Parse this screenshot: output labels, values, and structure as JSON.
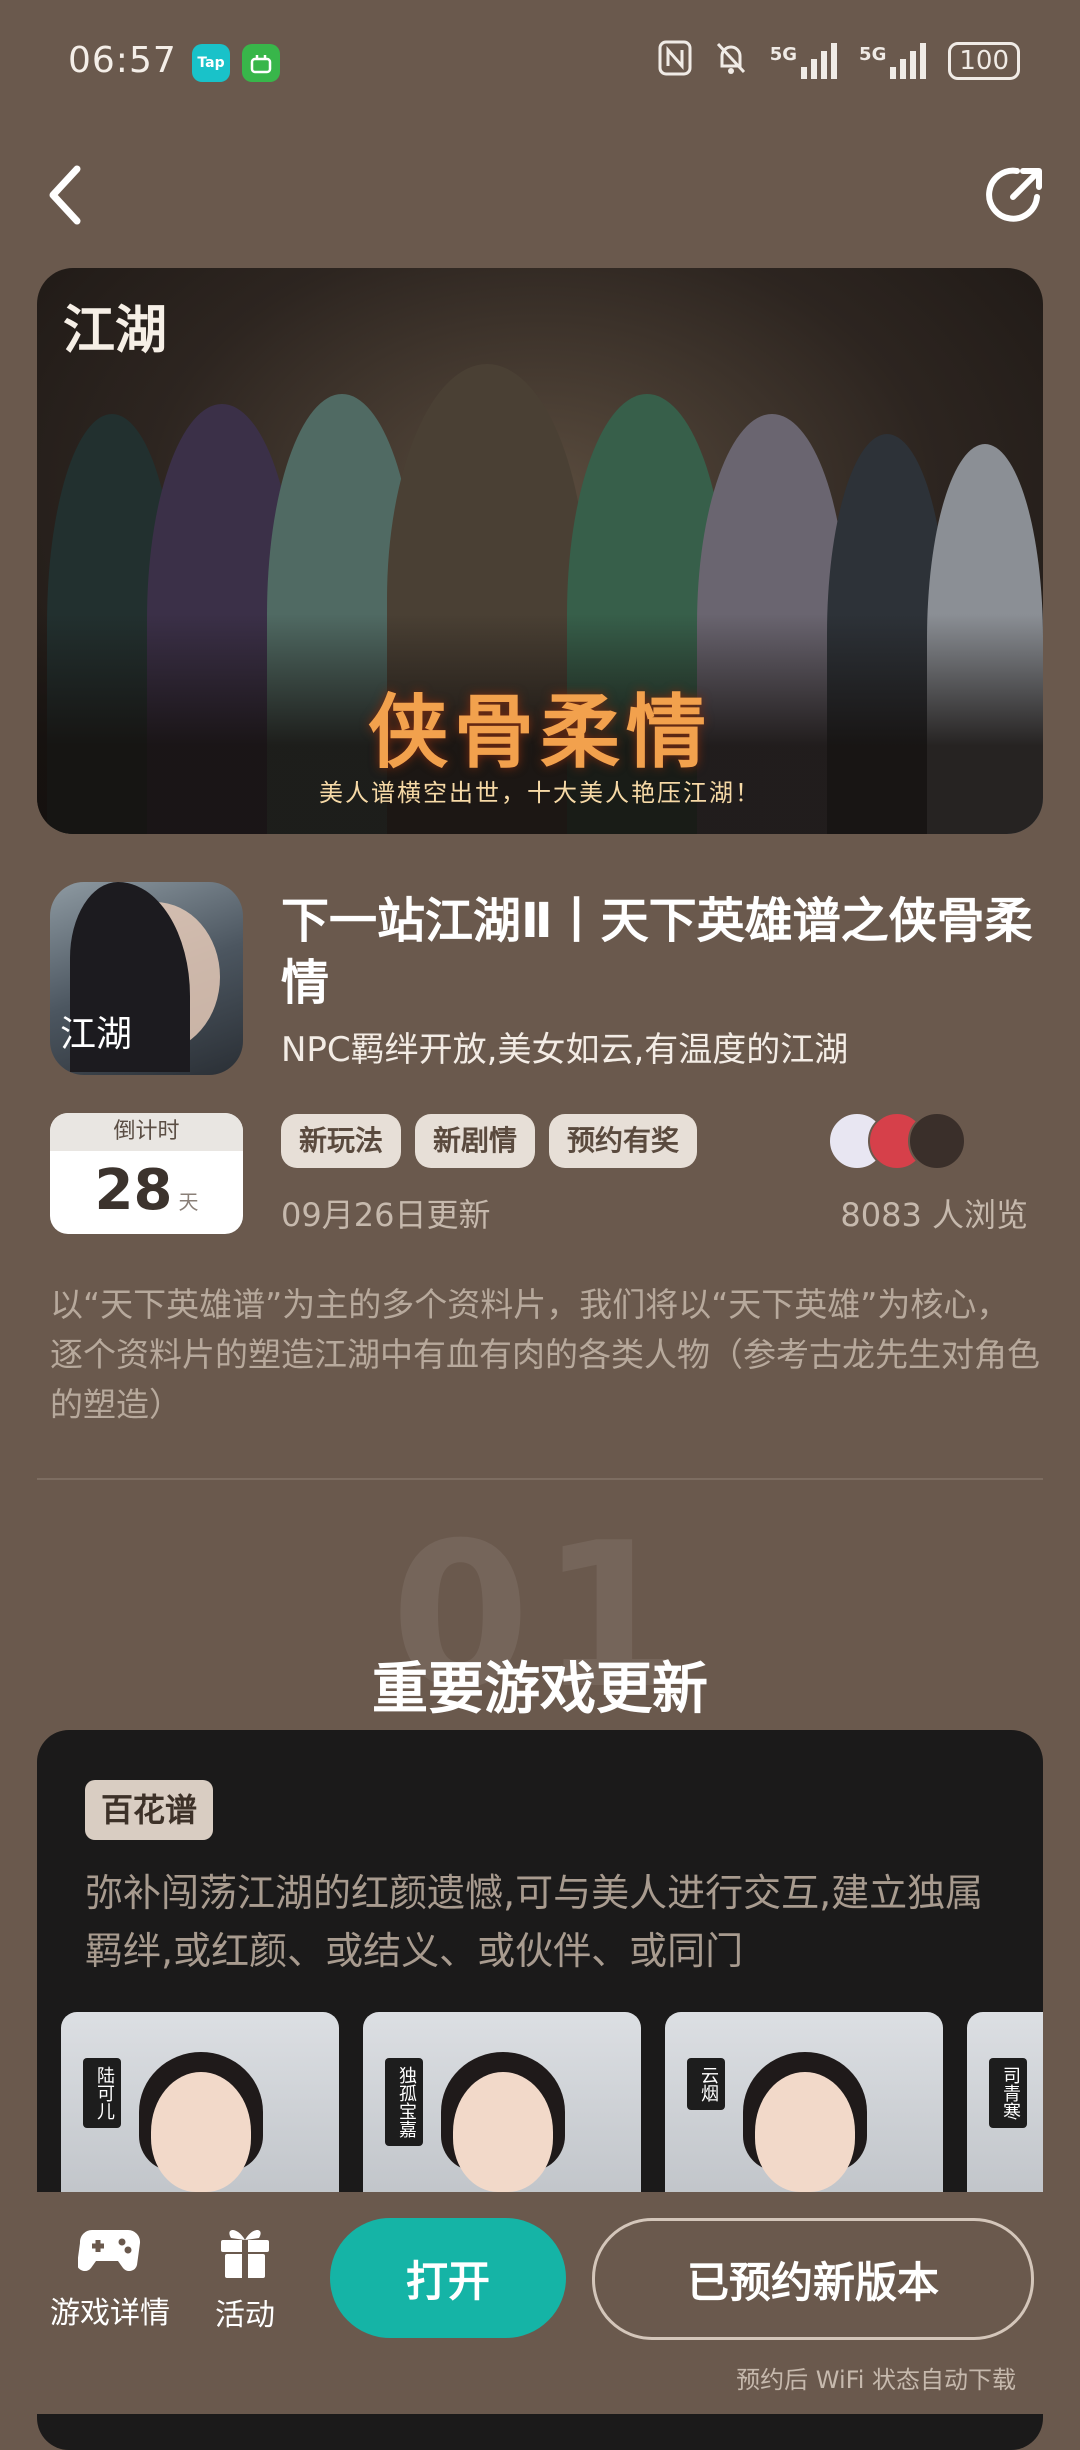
{
  "status_bar": {
    "time": "06:57",
    "app_badges": [
      "Tap",
      "应用"
    ],
    "network1": "5G",
    "network2": "5G",
    "battery": "100"
  },
  "nav": {
    "back_icon": "chevron-left-icon",
    "share_icon": "share-icon"
  },
  "banner": {
    "logo_text": "江湖",
    "title": "侠骨柔情",
    "subtitle": "美人谱横空出世，十大美人艳压江湖！"
  },
  "game": {
    "icon_text": "江湖",
    "title": "下一站江湖Ⅱ丨天下英雄谱之侠骨柔情",
    "slogan": "NPC羁绊开放,美女如云,有温度的江湖"
  },
  "countdown": {
    "label": "倒计时",
    "value": "28",
    "unit": "天"
  },
  "tags": [
    "新玩法",
    "新剧情",
    "预约有奖"
  ],
  "update_date": "09月26日更新",
  "views": "8083 人浏览",
  "description": "以“天下英雄谱”为主的多个资料片，我们将以“天下英雄”为核心，逐个资料片的塑造江湖中有血有肉的各类人物（参考古龙先生对角色的塑造）",
  "section": {
    "number": "01",
    "title": "重要游戏更新"
  },
  "feature_card": {
    "badge": "百花谱",
    "description": "弥补闯荡江湖的红颜遗憾,可与美人进行交互,建立独属羁绊,或红颜、或结义、或伙伴、或同门",
    "characters": [
      "陆可儿",
      "独孤宝嘉",
      "云烟",
      "司青寒"
    ]
  },
  "bottom_bar": {
    "tab_details": "游戏详情",
    "tab_activity": "活动",
    "open_button": "打开",
    "reserved_button": "已预约新版本",
    "reserve_note": "预约后 WiFi 状态自动下载"
  },
  "colors": {
    "background": "#6a594d",
    "accent": "#15b4a6",
    "banner_title": "#f2a14d",
    "card": "#1b1a1a"
  }
}
